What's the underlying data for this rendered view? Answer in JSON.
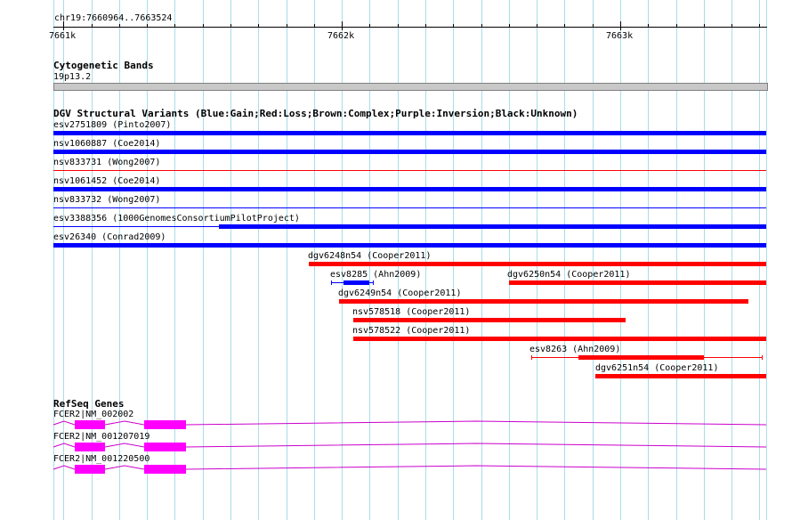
{
  "ruler": {
    "position_label": "chr19:7660964..7663524",
    "ticks": [
      {
        "label": "7661k",
        "value": 7661000
      },
      {
        "label": "7662k",
        "value": 7662000
      },
      {
        "label": "7663k",
        "value": 7663000
      }
    ],
    "range": [
      7660964,
      7663524
    ]
  },
  "cytoband": {
    "title": "Cytogenetic Bands",
    "band_label": "19p13.2",
    "color": "#c8c8c8"
  },
  "dgv": {
    "title": "DGV Structural Variants (Blue:Gain;Red:Loss;Brown:Complex;Purple:Inversion;Black:Unknown)",
    "colors": {
      "gain": "#0000ff",
      "loss": "#ff0000"
    },
    "tracks": [
      {
        "label": "esv2751809 (Pinto2007)",
        "type": "gain",
        "style": "thick",
        "start": 7660964,
        "end": 7663524
      },
      {
        "label": "nsv1060887 (Coe2014)",
        "type": "gain",
        "style": "thick",
        "start": 7660964,
        "end": 7663524
      },
      {
        "label": "nsv833731 (Wong2007)",
        "type": "loss",
        "style": "thin",
        "start": 7660964,
        "end": 7663524
      },
      {
        "label": "nsv1061452 (Coe2014)",
        "type": "gain",
        "style": "thick",
        "start": 7660964,
        "end": 7663524
      },
      {
        "label": "nsv833732 (Wong2007)",
        "type": "gain",
        "style": "thin",
        "start": 7660964,
        "end": 7663524
      },
      {
        "label": "esv3388356 (1000GenomesConsortiumPilotProject)",
        "type": "gain",
        "style": "thin_then_thick",
        "start": 7660964,
        "end": 7663524,
        "thick_start": 7661560
      },
      {
        "label": "esv26340 (Conrad2009)",
        "type": "gain",
        "style": "thick",
        "start": 7660964,
        "end": 7663524
      },
      {
        "label": "dgv6248n54 (Cooper2011)",
        "type": "loss",
        "style": "thick",
        "start": 7661880,
        "end": 7663524
      },
      {
        "label": "esv8285 (Ahn2009)",
        "type": "gain",
        "style": "capped",
        "start": 7661960,
        "end": 7662115,
        "thick_start": 7662005,
        "thick_end": 7662100
      },
      {
        "label": "dgv6250n54 (Cooper2011)",
        "type": "loss",
        "style": "thick",
        "start": 7662600,
        "end": 7663524
      },
      {
        "label": "dgv6249n54 (Cooper2011)",
        "type": "loss",
        "style": "thick",
        "start": 7661990,
        "end": 7663460
      },
      {
        "label": "nsv578518 (Cooper2011)",
        "type": "loss",
        "style": "thick",
        "start": 7662040,
        "end": 7663020
      },
      {
        "label": "nsv578522 (Cooper2011)",
        "type": "loss",
        "style": "thick",
        "start": 7662040,
        "end": 7663524
      },
      {
        "label": "esv8263 (Ahn2009)",
        "type": "loss",
        "style": "capped",
        "start": 7662680,
        "end": 7663510,
        "thick_start": 7662850,
        "thick_end": 7663300
      },
      {
        "label": "dgv6251n54 (Cooper2011)",
        "type": "loss",
        "style": "thick",
        "start": 7662910,
        "end": 7663524
      }
    ]
  },
  "refseq": {
    "title": "RefSeq Genes",
    "color": "#ff00ff",
    "line_color": "#cc00cc",
    "genes": [
      {
        "label": "FCER2|NM_002002",
        "exons": [
          [
            7661040,
            7661150
          ],
          [
            7661290,
            7661440
          ]
        ]
      },
      {
        "label": "FCER2|NM_001207019",
        "exons": [
          [
            7661040,
            7661150
          ],
          [
            7661290,
            7661440
          ]
        ]
      },
      {
        "label": "FCER2|NM_001220500",
        "exons": [
          [
            7661040,
            7661150
          ],
          [
            7661290,
            7661440
          ]
        ]
      }
    ]
  }
}
